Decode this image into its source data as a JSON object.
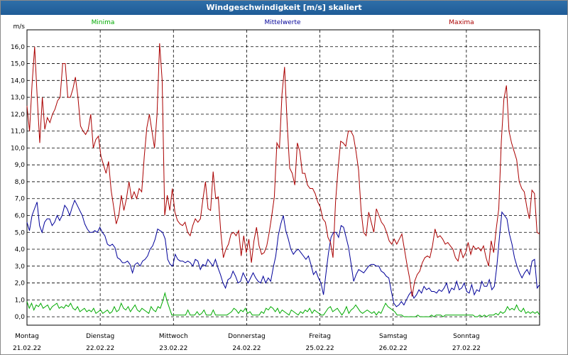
{
  "chart_data": {
    "type": "line",
    "title": "Windgeschwindigkeit [m/s] skaliert",
    "ylabel": "m/s",
    "ylim": [
      -0.5,
      17
    ],
    "yticks": [
      "0,0",
      "1,0",
      "2,0",
      "3,0",
      "4,0",
      "5,0",
      "6,0",
      "7,0",
      "8,0",
      "9,0",
      "10,0",
      "11,0",
      "12,0",
      "13,0",
      "14,0",
      "15,0",
      "16,0"
    ],
    "grid": true,
    "x_day_labels": [
      {
        "day": "Montag",
        "date": "21.02.22"
      },
      {
        "day": "Dienstag",
        "date": "22.02.22"
      },
      {
        "day": "Mittwoch",
        "date": "23.02.22"
      },
      {
        "day": "Donnerstag",
        "date": "24.02.22"
      },
      {
        "day": "Freitag",
        "date": "25.02.22"
      },
      {
        "day": "Samstag",
        "date": "26.02.22"
      },
      {
        "day": "Sonntag",
        "date": "27.02.22"
      }
    ],
    "x_days": 7,
    "series": [
      {
        "name": "Minima",
        "color": "#00aa00",
        "values": [
          0.9,
          0.5,
          0.8,
          0.4,
          0.7,
          0.6,
          0.8,
          0.5,
          0.6,
          0.7,
          0.4,
          0.6,
          0.7,
          0.8,
          0.5,
          0.6,
          0.5,
          0.7,
          0.6,
          0.8,
          0.5,
          0.4,
          0.6,
          0.3,
          0.4,
          0.5,
          0.3,
          0.4,
          0.3,
          0.5,
          0.2,
          0.3,
          0.4,
          0.2,
          0.3,
          0.4,
          0.2,
          0.3,
          0.6,
          0.3,
          0.4,
          0.8,
          0.5,
          0.4,
          0.6,
          0.3,
          0.5,
          0.7,
          0.4,
          0.3,
          0.5,
          0.4,
          0.3,
          0.2,
          0.6,
          0.4,
          0.3,
          0.6,
          0.5,
          0.9,
          1.4,
          0.9,
          0.5,
          0.1,
          0.1,
          0.1,
          0.1,
          0.1,
          0.1,
          0.1,
          0.4,
          0.1,
          0.1,
          0.1,
          0.3,
          0.1,
          0.2,
          0.4,
          0.1,
          0.1,
          0.1,
          0.4,
          0.1,
          0.1,
          0.1,
          0.1,
          0.1,
          0.1,
          0.2,
          0.3,
          0.5,
          0.4,
          0.2,
          0.4,
          0.3,
          0.5,
          0.2,
          0.3,
          0.1,
          0.1,
          0.1,
          0.1,
          0.3,
          0.2,
          0.5,
          0.4,
          0.6,
          0.5,
          0.3,
          0.5,
          0.2,
          0.4,
          0.3,
          0.2,
          0.1,
          0.4,
          0.3,
          0.2,
          0.1,
          0.3,
          0.2,
          0.4,
          0.3,
          0.5,
          0.2,
          0.4,
          0.3,
          0.2,
          0.1,
          0.1,
          0.3,
          0.5,
          0.6,
          0.3,
          0.4,
          0.5,
          0.3,
          0.1,
          0.3,
          0.6,
          0.2,
          0.4,
          0.5,
          0.7,
          0.5,
          0.3,
          0.2,
          0.3,
          0.4,
          0.3,
          0.2,
          0.3,
          0.1,
          0.3,
          0.2,
          0.5,
          0.8,
          0.6,
          0.5,
          0.4,
          0.3,
          0.1,
          0.1,
          0.1,
          0.0,
          0.0,
          0.0,
          0.0,
          0.0,
          0.0,
          0.1,
          0.0,
          0.0,
          0.0,
          0.0,
          0.0,
          0.1,
          0.0,
          0.1,
          0.1,
          0.1,
          0.0,
          0.1,
          0.1,
          0.1,
          0.1,
          0.1,
          0.1,
          0.1,
          0.1,
          0.1,
          0.1,
          0.1,
          0.1,
          0.1,
          0.0,
          0.0,
          0.1,
          0.0,
          0.1,
          0.0,
          0.1,
          0.1,
          0.1,
          0.2,
          0.1,
          0.3,
          0.2,
          0.3,
          0.6,
          0.4,
          0.5,
          0.4,
          0.7,
          0.4,
          0.3,
          0.5,
          0.2,
          0.3,
          0.2,
          0.3,
          0.2,
          0.3,
          0.1
        ]
      },
      {
        "name": "Mittelwerte",
        "color": "#000099",
        "values": [
          5.6,
          5.1,
          6.0,
          6.4,
          6.8,
          5.4,
          5.0,
          5.6,
          5.8,
          5.8,
          5.4,
          5.6,
          6.0,
          5.7,
          6.0,
          6.6,
          6.4,
          6.0,
          6.5,
          6.9,
          6.6,
          6.3,
          6.0,
          5.5,
          5.2,
          5.0,
          5.0,
          5.1,
          5.0,
          5.3,
          5.0,
          4.8,
          4.3,
          4.2,
          4.3,
          4.1,
          3.5,
          3.4,
          3.2,
          3.2,
          3.3,
          3.1,
          2.6,
          3.1,
          3.2,
          3.0,
          3.3,
          3.4,
          3.6,
          4.0,
          4.2,
          4.6,
          5.2,
          5.1,
          5.0,
          4.6,
          3.4,
          3.1,
          3.0,
          3.7,
          3.4,
          3.3,
          3.3,
          3.2,
          3.3,
          3.2,
          3.0,
          3.4,
          3.3,
          2.8,
          3.1,
          3.0,
          3.4,
          3.2,
          3.0,
          3.4,
          2.9,
          2.5,
          2.0,
          1.7,
          2.2,
          2.3,
          2.7,
          2.4,
          2.0,
          2.1,
          2.6,
          2.3,
          2.0,
          2.3,
          2.6,
          2.3,
          2.1,
          2.0,
          2.4,
          2.0,
          2.3,
          2.1,
          2.9,
          3.6,
          4.8,
          5.5,
          6.0,
          5.1,
          4.6,
          4.0,
          3.7,
          3.9,
          4.0,
          3.8,
          3.6,
          3.4,
          3.6,
          3.1,
          2.5,
          2.7,
          2.3,
          2.0,
          1.3,
          2.6,
          3.8,
          4.7,
          5.0,
          5.0,
          4.7,
          5.4,
          5.3,
          4.7,
          4.1,
          3.1,
          2.1,
          2.5,
          2.8,
          2.7,
          2.6,
          2.8,
          3.0,
          3.1,
          3.1,
          3.0,
          3.0,
          2.7,
          2.6,
          2.4,
          2.3,
          1.5,
          0.8,
          0.6,
          0.7,
          0.9,
          0.7,
          1.0,
          1.3,
          1.5,
          1.1,
          1.3,
          1.6,
          1.4,
          1.8,
          1.6,
          1.7,
          1.5,
          1.5,
          1.4,
          1.6,
          1.5,
          1.7,
          2.0,
          1.4,
          1.7,
          1.6,
          2.1,
          1.6,
          1.7,
          2.0,
          1.5,
          1.4,
          1.9,
          1.3,
          1.6,
          1.5,
          2.1,
          1.8,
          1.8,
          2.2,
          1.6,
          1.8,
          3.0,
          4.7,
          6.2,
          6.0,
          5.8,
          4.9,
          4.3,
          3.5,
          3.0,
          2.6,
          2.3,
          2.6,
          2.8,
          2.5,
          3.3,
          3.4,
          1.7,
          1.9
        ]
      },
      {
        "name": "Maxima",
        "color": "#aa0000",
        "values": [
          12.5,
          11.0,
          13.8,
          16.0,
          13.0,
          10.3,
          13.0,
          11.1,
          11.8,
          11.5,
          12.0,
          12.3,
          12.8,
          13.0,
          15.0,
          15.0,
          13.0,
          13.0,
          13.5,
          14.2,
          13.0,
          11.3,
          11.0,
          10.8,
          11.1,
          12.0,
          10.0,
          10.5,
          10.7,
          9.5,
          9.0,
          8.5,
          9.2,
          7.5,
          6.5,
          5.5,
          6.0,
          7.2,
          6.3,
          7.0,
          8.0,
          7.0,
          7.4,
          7.0,
          7.6,
          7.4,
          9.5,
          11.2,
          12.0,
          11.0,
          10.0,
          12.0,
          16.2,
          14.0,
          6.0,
          7.2,
          6.3,
          7.6,
          6.2,
          5.7,
          5.5,
          5.4,
          5.6,
          5.0,
          4.8,
          5.4,
          5.8,
          5.6,
          5.8,
          7.0,
          8.0,
          6.4,
          6.3,
          8.6,
          7.0,
          7.1,
          5.0,
          3.5,
          4.0,
          4.3,
          4.9,
          5.0,
          4.8,
          5.1,
          3.6,
          4.8,
          3.8,
          4.6,
          3.2,
          4.5,
          5.3,
          4.2,
          3.7,
          3.8,
          4.2,
          5.0,
          6.0,
          7.1,
          10.3,
          10.0,
          13.2,
          14.8,
          11.5,
          8.8,
          8.5,
          7.8,
          10.3,
          9.8,
          8.5,
          8.5,
          7.8,
          7.6,
          7.6,
          7.3,
          6.8,
          6.5,
          5.8,
          5.6,
          4.7,
          4.4,
          3.5,
          6.8,
          8.8,
          10.4,
          10.3,
          10.1,
          11.0,
          11.0,
          10.7,
          9.8,
          8.7,
          6.3,
          5.0,
          4.8,
          6.2,
          5.6,
          5.0,
          6.4,
          6.0,
          5.6,
          5.4,
          5.0,
          4.5,
          4.3,
          4.6,
          4.3,
          4.6,
          4.9,
          4.0,
          3.1,
          2.3,
          1.2,
          2.1,
          2.5,
          2.7,
          3.2,
          3.5,
          3.6,
          3.5,
          4.2,
          5.2,
          4.7,
          4.8,
          4.6,
          4.3,
          4.4,
          4.2,
          4.0,
          3.5,
          3.3,
          4.0,
          3.5,
          3.8,
          4.4,
          3.7,
          4.2,
          4.0,
          4.1,
          3.9,
          4.2,
          3.5,
          3.0,
          4.5,
          3.8,
          5.2,
          6.4,
          10.4,
          12.9,
          13.7,
          11.0,
          10.3,
          9.8,
          9.3,
          8.0,
          7.6,
          7.4,
          6.5,
          5.8,
          7.5,
          7.3,
          5.0,
          4.9
        ]
      }
    ]
  }
}
